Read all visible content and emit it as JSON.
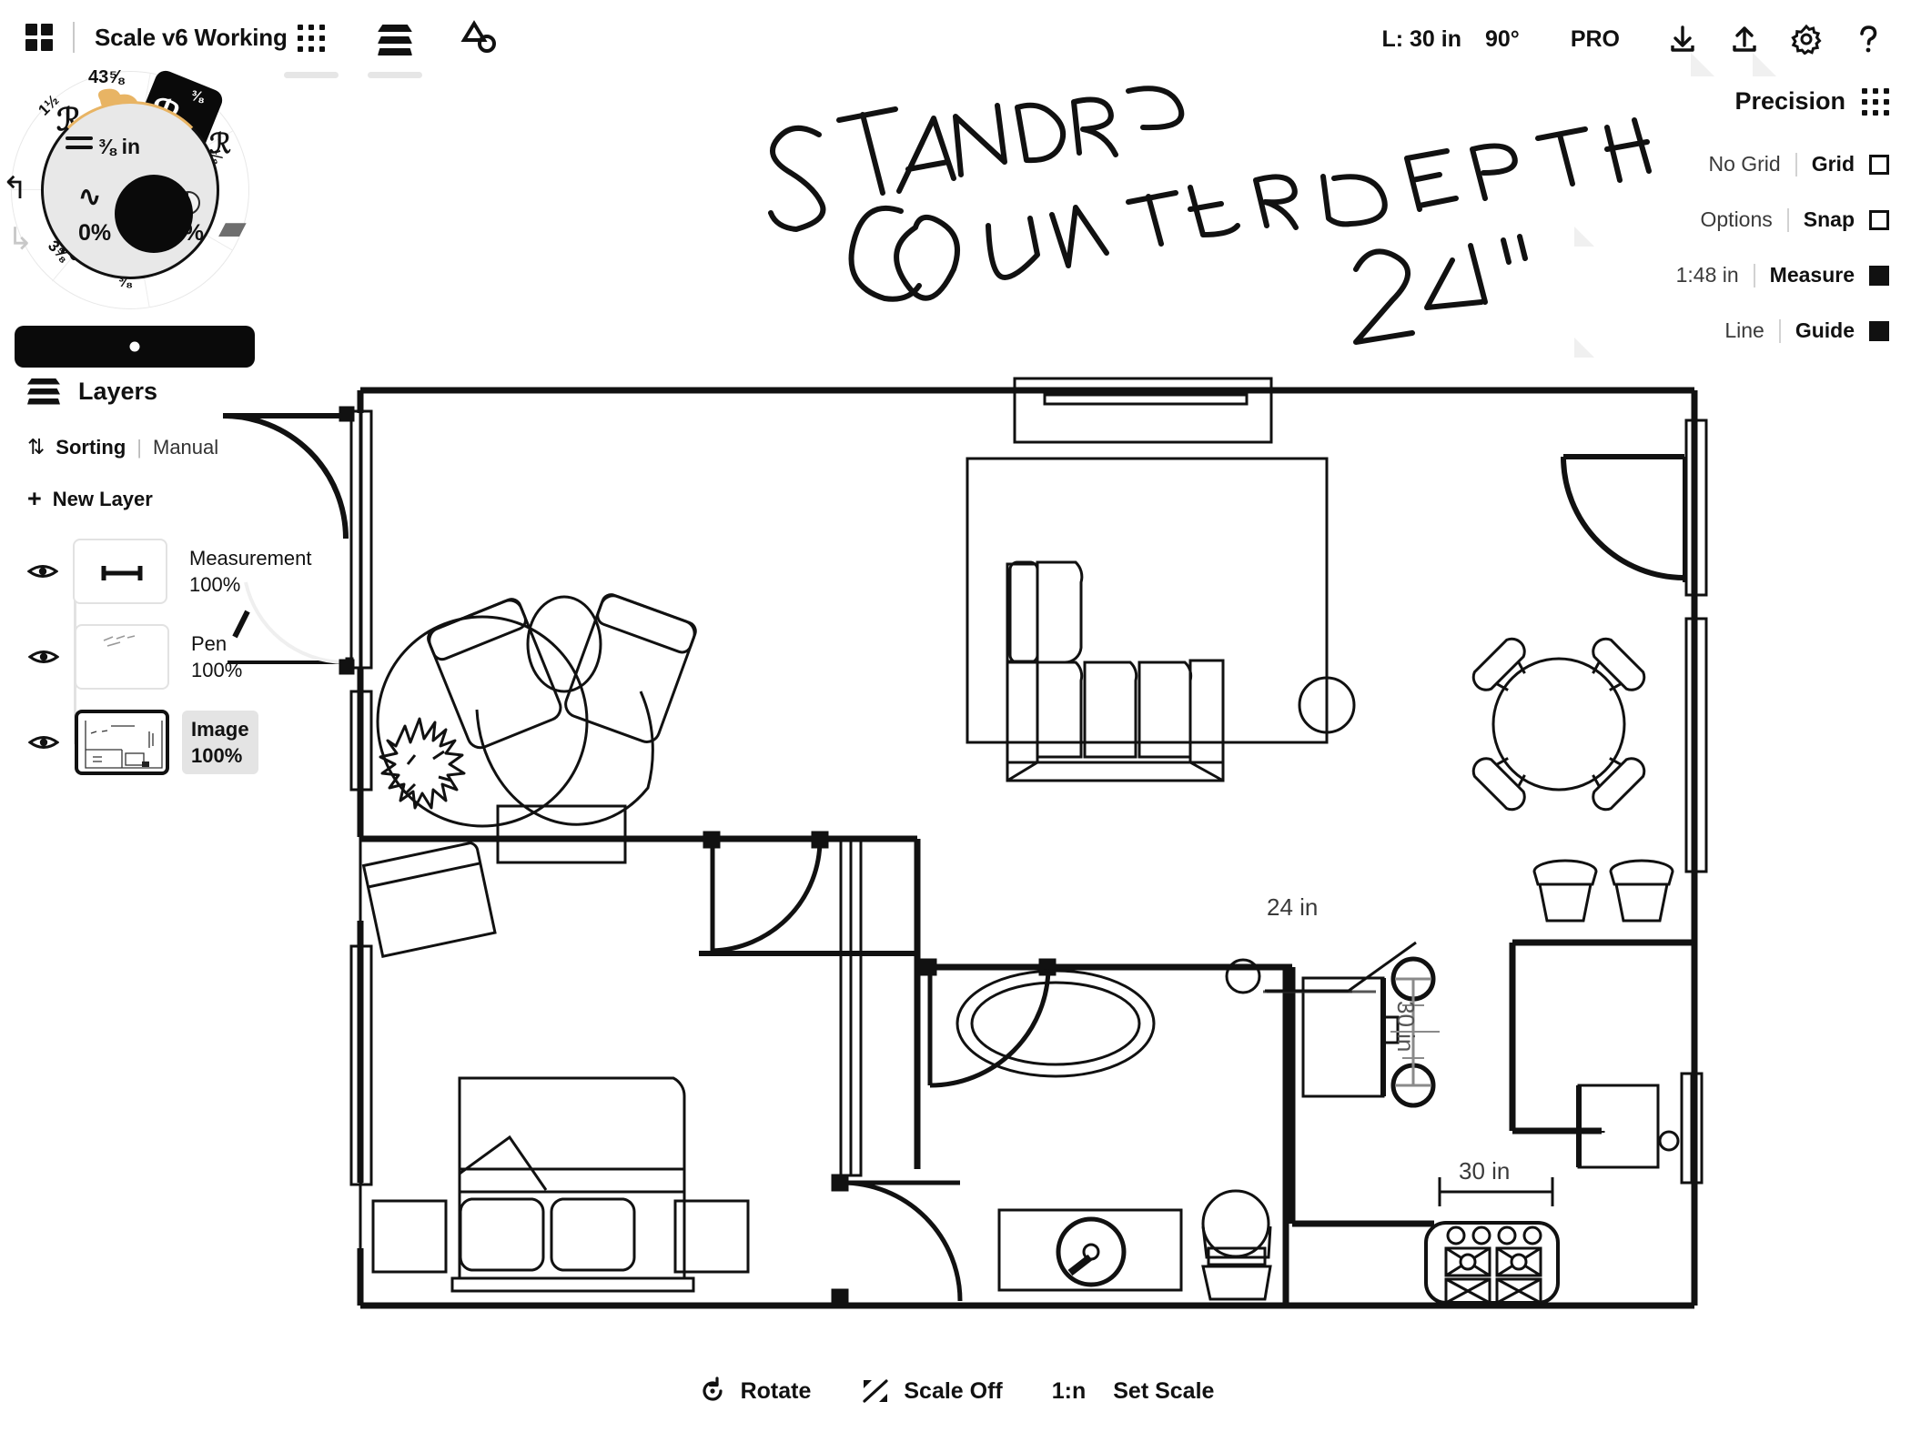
{
  "topbar": {
    "app_menu_icon": "grid-four-icon",
    "doc_title": "Scale v6 Working",
    "tools": [
      {
        "icon": "dots-grid-icon",
        "name": "objects-tool"
      },
      {
        "icon": "layers-stack-icon",
        "name": "layers-tool"
      },
      {
        "icon": "shape-select-icon",
        "name": "shape-tool"
      }
    ],
    "length_label": "L: 30 in",
    "angle_label": "90°",
    "pro_label": "PRO",
    "actions": [
      {
        "icon": "download-icon",
        "name": "download-button"
      },
      {
        "icon": "upload-icon",
        "name": "upload-button"
      },
      {
        "icon": "gear-icon",
        "name": "settings-button"
      },
      {
        "icon": "help-icon",
        "name": "help-button"
      }
    ]
  },
  "wheel": {
    "size_label": "⅜ in",
    "min_opacity": "0%",
    "max_opacity": "100%",
    "swatch_value": "43⅝",
    "selected_tile_size": "⅜",
    "segment_labels": [
      "1½",
      "43⅝",
      "⅜",
      "⅛",
      "",
      "⅜",
      "3⅝"
    ],
    "accent_color": "#E8B464",
    "tile_color": "#0A0A0A"
  },
  "layers": {
    "header": "Layers",
    "sorting_label": "Sorting",
    "sorting_value": "Manual",
    "new_layer_label": "New Layer",
    "items": [
      {
        "name": "Measurement",
        "opacity": "100%",
        "thumb": "measurement-thumb",
        "selected": false
      },
      {
        "name": "Pen",
        "opacity": "100%",
        "thumb": "pen-thumb",
        "selected": false
      },
      {
        "name": "Image",
        "opacity": "100%",
        "thumb": "image-thumb",
        "selected": true
      }
    ]
  },
  "precision": {
    "title": "Precision",
    "rows": [
      {
        "left": "No Grid",
        "right": "Grid",
        "checked": false
      },
      {
        "left": "Options",
        "right": "Snap",
        "checked": false
      },
      {
        "left": "1:48 in",
        "right": "Measure",
        "checked": true
      },
      {
        "left": "Line",
        "right": "Guide",
        "checked": true
      }
    ]
  },
  "annotations": {
    "handwriting_line1": "STANDARD",
    "handwriting_line2": "COUNTER DEPTH",
    "handwriting_line3": "24\"",
    "dim_counter_depth": "24 in",
    "dim_vertical": "30 in",
    "dim_range": "30 in"
  },
  "bottombar": {
    "items": [
      {
        "icon": "rotate-icon",
        "label": "Rotate"
      },
      {
        "icon": "scale-icon",
        "label": "Scale Off"
      },
      {
        "icon": "",
        "ratio": "1:n",
        "label": "Set Scale"
      }
    ]
  }
}
